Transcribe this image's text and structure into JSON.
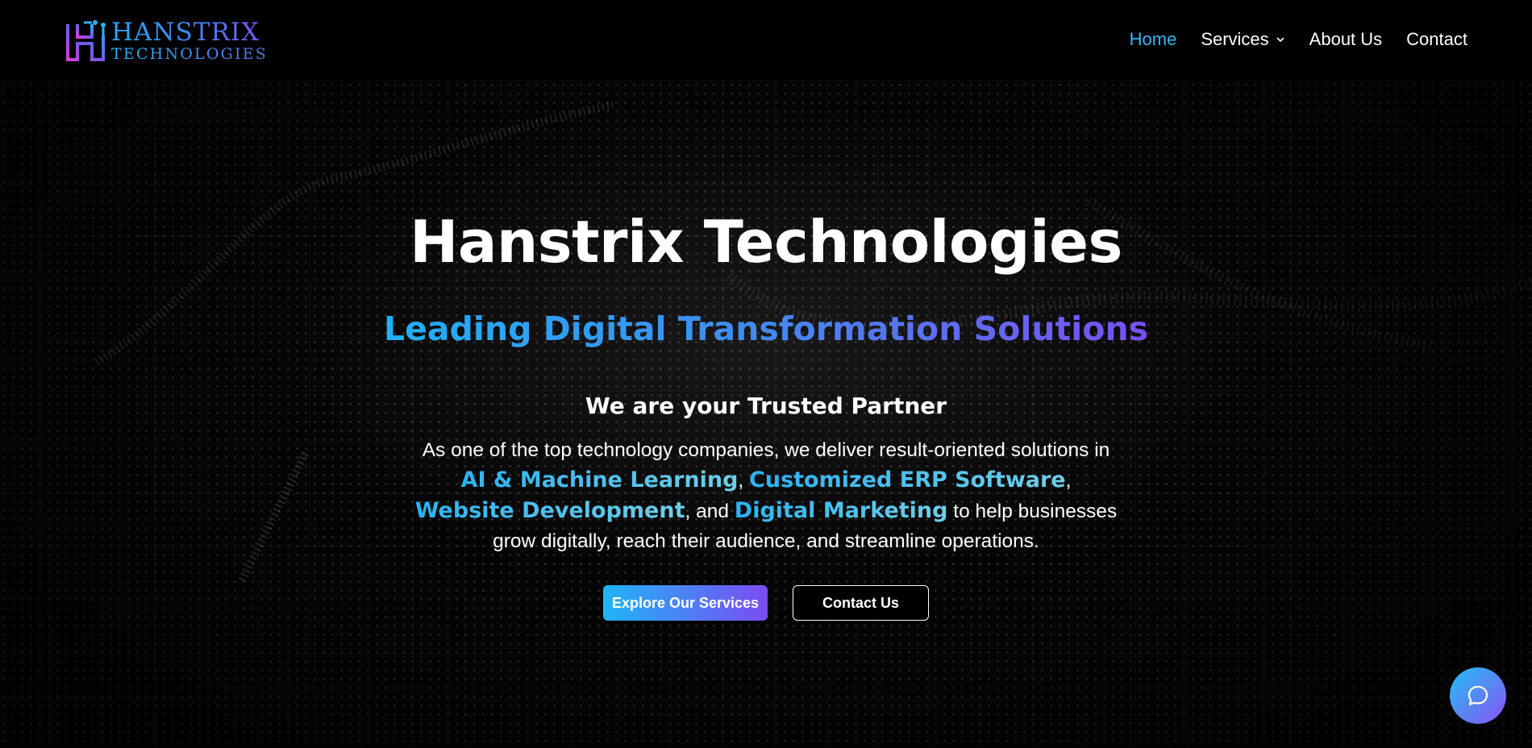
{
  "brand": {
    "name_line1": "HANSTRIX",
    "name_line2": "TECHNOLOGIES",
    "logo_icon": "hanstrix-h-logo-icon"
  },
  "nav": {
    "items": [
      {
        "label": "Home",
        "active": true
      },
      {
        "label": "Services",
        "has_dropdown": true
      },
      {
        "label": "About Us"
      },
      {
        "label": "Contact"
      }
    ]
  },
  "hero": {
    "title": "Hanstrix Technologies",
    "subtitle": "Leading Digital Transformation Solutions",
    "tagline": "We are your Trusted Partner",
    "description": {
      "intro": "As one of the top technology companies, we deliver result-oriented solutions in",
      "highlight1": "AI & Machine Learning",
      "sep1": ",",
      "highlight2": "Customized ERP Software",
      "sep2": ",",
      "highlight3": "Website Development",
      "sep3": ", and",
      "highlight4": "Digital Marketing",
      "outro": "to help businesses grow digitally, reach their audience, and streamline operations."
    },
    "primary_button": "Explore Our Services",
    "secondary_button": "Contact Us"
  },
  "chat": {
    "icon": "chat-bubble-icon"
  },
  "colors": {
    "accent_blue": "#34b7f2",
    "accent_purple": "#7b4cf2",
    "background": "#000000"
  }
}
